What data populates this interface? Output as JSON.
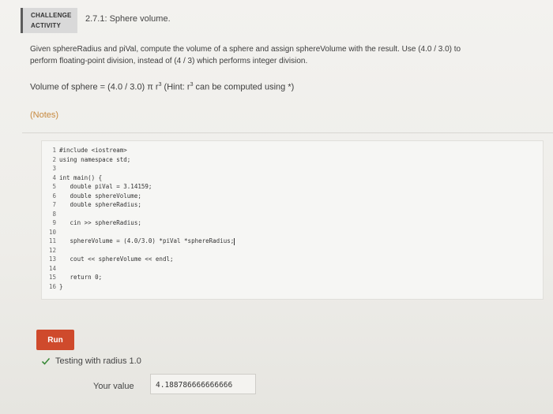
{
  "header": {
    "badge_line1": "CHALLENGE",
    "badge_line2": "ACTIVITY",
    "title": "2.7.1: Sphere volume."
  },
  "description": {
    "line1": "Given sphereRadius and piVal, compute the volume of a sphere and assign sphereVolume with the result. Use (4.0 / 3.0) to",
    "line2": "perform floating-point division, instead of (4 / 3) which performs integer division."
  },
  "formula": {
    "prefix": "Volume of sphere = (4.0 / 3.0) π r",
    "exp1": "3",
    "middle": " (Hint: r",
    "exp2": "3",
    "suffix": " can be computed using *)"
  },
  "notes_label": "(Notes)",
  "editor": {
    "line_numbers": [
      "1",
      "2",
      "3",
      "4",
      "5",
      "6",
      "7",
      "8",
      "9",
      "10",
      "11",
      "12",
      "13",
      "14",
      "15",
      "16"
    ],
    "lines": [
      "#include <iostream>",
      "using namespace std;",
      "",
      "int main() {",
      "   double piVal = 3.14159;",
      "   double sphereVolume;",
      "   double sphereRadius;",
      "",
      "   cin >> sphereRadius;",
      "",
      "   sphereVolume = (4.0/3.0) *piVal *sphereRadius;",
      "",
      "   cout << sphereVolume << endl;",
      "",
      "   return 0;",
      "}"
    ]
  },
  "run_button_label": "Run",
  "test": {
    "label": "Testing with radius 1.0",
    "your_value_label": "Your value",
    "your_value": "4.188786666666666"
  },
  "colors": {
    "run_button": "#cf4a2c",
    "notes": "#c7893e",
    "check": "#3a8a3a"
  }
}
